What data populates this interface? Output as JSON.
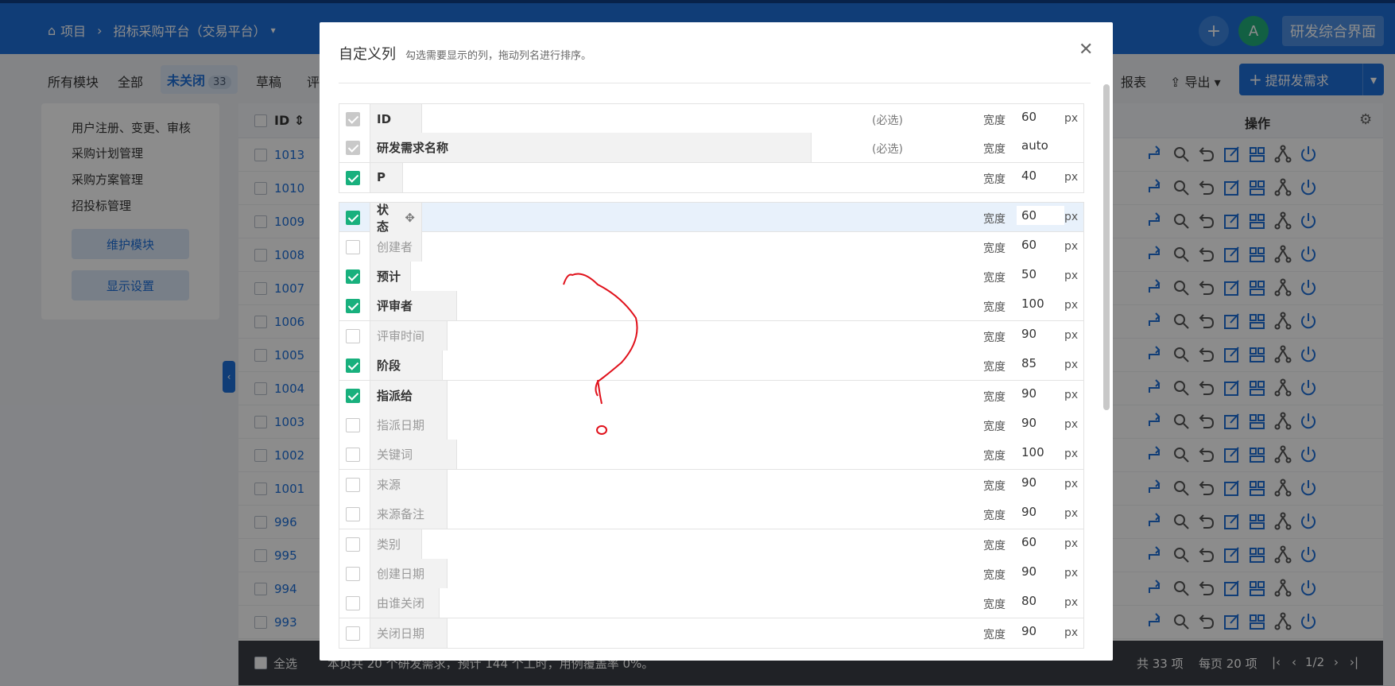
{
  "topbar": {
    "breadcrumb_home": "项目",
    "breadcrumb_project": "招标采购平台（交易平台）",
    "avatar_letter": "A",
    "interface_button": "研发综合界面"
  },
  "subbar": {
    "tabs": [
      "所有模块",
      "全部",
      "未关闭",
      "草稿",
      "评"
    ],
    "unclosed_count": "33",
    "report": "报表",
    "export": "导出",
    "create_button": "提研发需求"
  },
  "side": {
    "modules": [
      "用户注册、变更、审核",
      "采购计划管理",
      "采购方案管理",
      "招投标管理"
    ],
    "maintain_button": "维护模块",
    "display_button": "显示设置"
  },
  "table": {
    "id_header": "ID",
    "ops_header": "操作",
    "ids": [
      "1013",
      "1010",
      "1009",
      "1008",
      "1007",
      "1006",
      "1005",
      "1004",
      "1003",
      "1002",
      "1001",
      "996",
      "995",
      "994",
      "993"
    ],
    "footer": {
      "select_all": "全选",
      "summary": "本页共 20 个研发需求，预计 144 个工时，用例覆盖率 0%。",
      "total": "共 33 项",
      "per_page": "每页 20 项",
      "page": "1/2"
    }
  },
  "modal": {
    "title": "自定义列",
    "hint": "勾选需要显示的列，拖动列名进行排序。",
    "width_label": "宽度",
    "unit": "px",
    "required_label": "(必选)",
    "columns": [
      {
        "name": "ID",
        "checked": "required",
        "width": "60",
        "unit": true,
        "required": true
      },
      {
        "name": "研发需求名称",
        "checked": "required",
        "width": "auto",
        "unit": false,
        "required": true
      },
      {
        "name": "P",
        "checked": "on",
        "width": "40",
        "unit": true
      },
      {
        "name": "状态",
        "checked": "on",
        "width": "60",
        "unit": true,
        "drag": true
      },
      {
        "name": "创建者",
        "checked": "off",
        "width": "60",
        "unit": true
      },
      {
        "name": "预计",
        "checked": "on",
        "width": "50",
        "unit": true
      },
      {
        "name": "评审者",
        "checked": "on",
        "width": "100",
        "unit": true
      },
      {
        "name": "评审时间",
        "checked": "off",
        "width": "90",
        "unit": true
      },
      {
        "name": "阶段",
        "checked": "on",
        "width": "85",
        "unit": true
      },
      {
        "name": "指派给",
        "checked": "on",
        "width": "90",
        "unit": true
      },
      {
        "name": "指派日期",
        "checked": "off",
        "width": "90",
        "unit": true
      },
      {
        "name": "关键词",
        "checked": "off",
        "width": "100",
        "unit": true
      },
      {
        "name": "来源",
        "checked": "off",
        "width": "90",
        "unit": true
      },
      {
        "name": "来源备注",
        "checked": "off",
        "width": "90",
        "unit": true
      },
      {
        "name": "类别",
        "checked": "off",
        "width": "60",
        "unit": true
      },
      {
        "name": "创建日期",
        "checked": "off",
        "width": "90",
        "unit": true
      },
      {
        "name": "由谁关闭",
        "checked": "off",
        "width": "80",
        "unit": true
      },
      {
        "name": "关闭日期",
        "checked": "off",
        "width": "90",
        "unit": true
      }
    ]
  },
  "colors": {
    "primary": "#1e6fd9",
    "check_green": "#18b07d",
    "annotation_red": "#e0101a"
  }
}
